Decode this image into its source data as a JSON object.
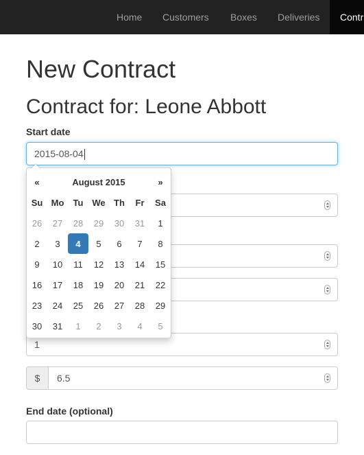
{
  "nav": {
    "home": "Home",
    "customers": "Customers",
    "boxes": "Boxes",
    "deliveries": "Deliveries",
    "contracts": "Contracts"
  },
  "page": {
    "title": "New Contract",
    "subtitle": "Contract for: Leone Abbott"
  },
  "form": {
    "start_label": "Start date",
    "start_value": "2015-08-04",
    "quantity_value": "1",
    "currency_symbol": "$",
    "price_value": "6.5",
    "end_label": "End date (optional)",
    "end_value": ""
  },
  "datepicker": {
    "prev": "«",
    "next": "»",
    "month_label": "August 2015",
    "weekdays": [
      "Su",
      "Mo",
      "Tu",
      "We",
      "Th",
      "Fr",
      "Sa"
    ],
    "weeks": [
      [
        "26",
        "27",
        "28",
        "29",
        "30",
        "31",
        "1"
      ],
      [
        "2",
        "3",
        "4",
        "5",
        "6",
        "7",
        "8"
      ],
      [
        "9",
        "10",
        "11",
        "12",
        "13",
        "14",
        "15"
      ],
      [
        "16",
        "17",
        "18",
        "19",
        "20",
        "21",
        "22"
      ],
      [
        "23",
        "24",
        "25",
        "26",
        "27",
        "28",
        "29"
      ],
      [
        "30",
        "31",
        "1",
        "2",
        "3",
        "4",
        "5"
      ]
    ],
    "selected_day": "4"
  },
  "colors": {
    "navbar_bg": "#222222",
    "nav_active_bg": "#080808",
    "selected_day_bg": "#337ab7",
    "focus_border": "#66afe9"
  }
}
